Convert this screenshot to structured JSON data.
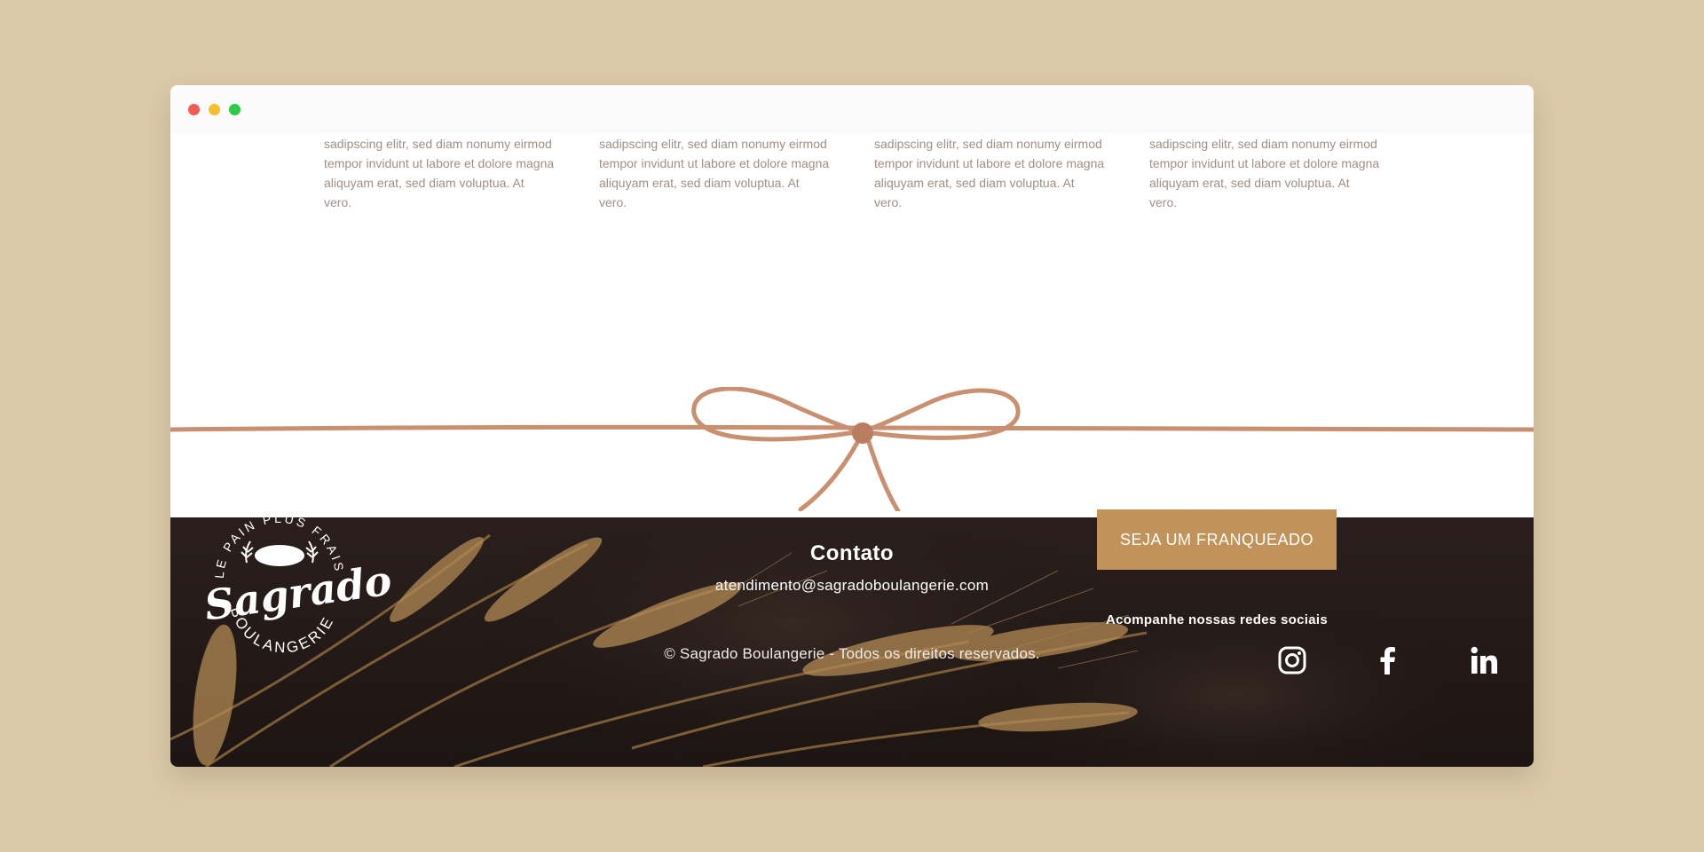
{
  "features": [
    {
      "text": "sadipscing elitr, sed diam nonumy eirmod tempor invidunt ut labore et dolore magna aliquyam erat, sed diam voluptua. At vero."
    },
    {
      "text": "sadipscing elitr, sed diam nonumy eirmod tempor invidunt ut labore et dolore magna aliquyam erat, sed diam voluptua. At vero."
    },
    {
      "text": "sadipscing elitr, sed diam nonumy eirmod tempor invidunt ut labore et dolore magna aliquyam erat, sed diam voluptua. At vero."
    },
    {
      "text": "sadipscing elitr, sed diam nonumy eirmod tempor invidunt ut labore et dolore magna aliquyam erat, sed diam voluptua. At vero."
    }
  ],
  "logo": {
    "top_text": "LE PAIN PLUS FRAIS",
    "script": "Sagrado",
    "bottom_text": "BOULANGERIE"
  },
  "contact": {
    "heading": "Contato",
    "email": "atendimento@sagradoboulangerie.com"
  },
  "copyright": "© Sagrado Boulangerie - Todos os direitos reservados.",
  "cta": {
    "label": "SEJA UM FRANQUEADO"
  },
  "social": {
    "title": "Acompanhe nossas redes sociais",
    "icons": [
      "instagram-icon",
      "facebook-icon",
      "linkedin-icon"
    ]
  },
  "colors": {
    "page_background": "#dcc9a8",
    "accent": "#c1925a",
    "footer_background": "#231a17",
    "body_text": "#a08f86"
  }
}
